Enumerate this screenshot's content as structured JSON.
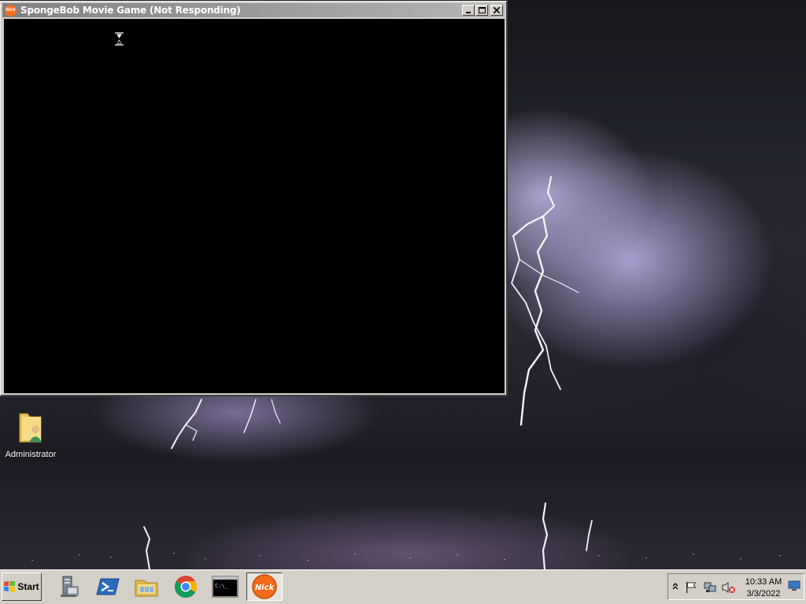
{
  "window": {
    "title": "SpongeBob Movie Game (Not Responding)",
    "app_logo_text": "Nick",
    "minimize_icon": "minimize-icon",
    "maximize_icon": "maximize-icon",
    "close_icon": "close-icon"
  },
  "desktop": {
    "icons": [
      {
        "label": "Administrator",
        "icon": "user-folder-icon"
      }
    ]
  },
  "taskbar": {
    "start_label": "Start",
    "pinned": [
      {
        "name": "server-manager",
        "icon": "server-manager-icon"
      },
      {
        "name": "powershell",
        "icon": "powershell-icon"
      },
      {
        "name": "file-explorer",
        "icon": "folder-icon"
      },
      {
        "name": "chrome",
        "icon": "chrome-icon"
      },
      {
        "name": "command-prompt",
        "icon": "cmd-icon",
        "glyph": "C:\\_"
      },
      {
        "name": "spongebob-game",
        "icon": "nick-icon",
        "text": "Nick",
        "active": true
      }
    ]
  },
  "tray": {
    "icons": [
      "show-hidden-icons-icon",
      "action-center-flag-icon",
      "network-icon",
      "volume-muted-icon"
    ],
    "time": "10:33 AM",
    "date": "3/3/2022",
    "show_desktop_icon": "show-desktop-icon"
  },
  "colors": {
    "nick_orange": "#f26a1b",
    "taskbar_gray": "#d4d0c8",
    "title_bar_gray": "#808080"
  }
}
